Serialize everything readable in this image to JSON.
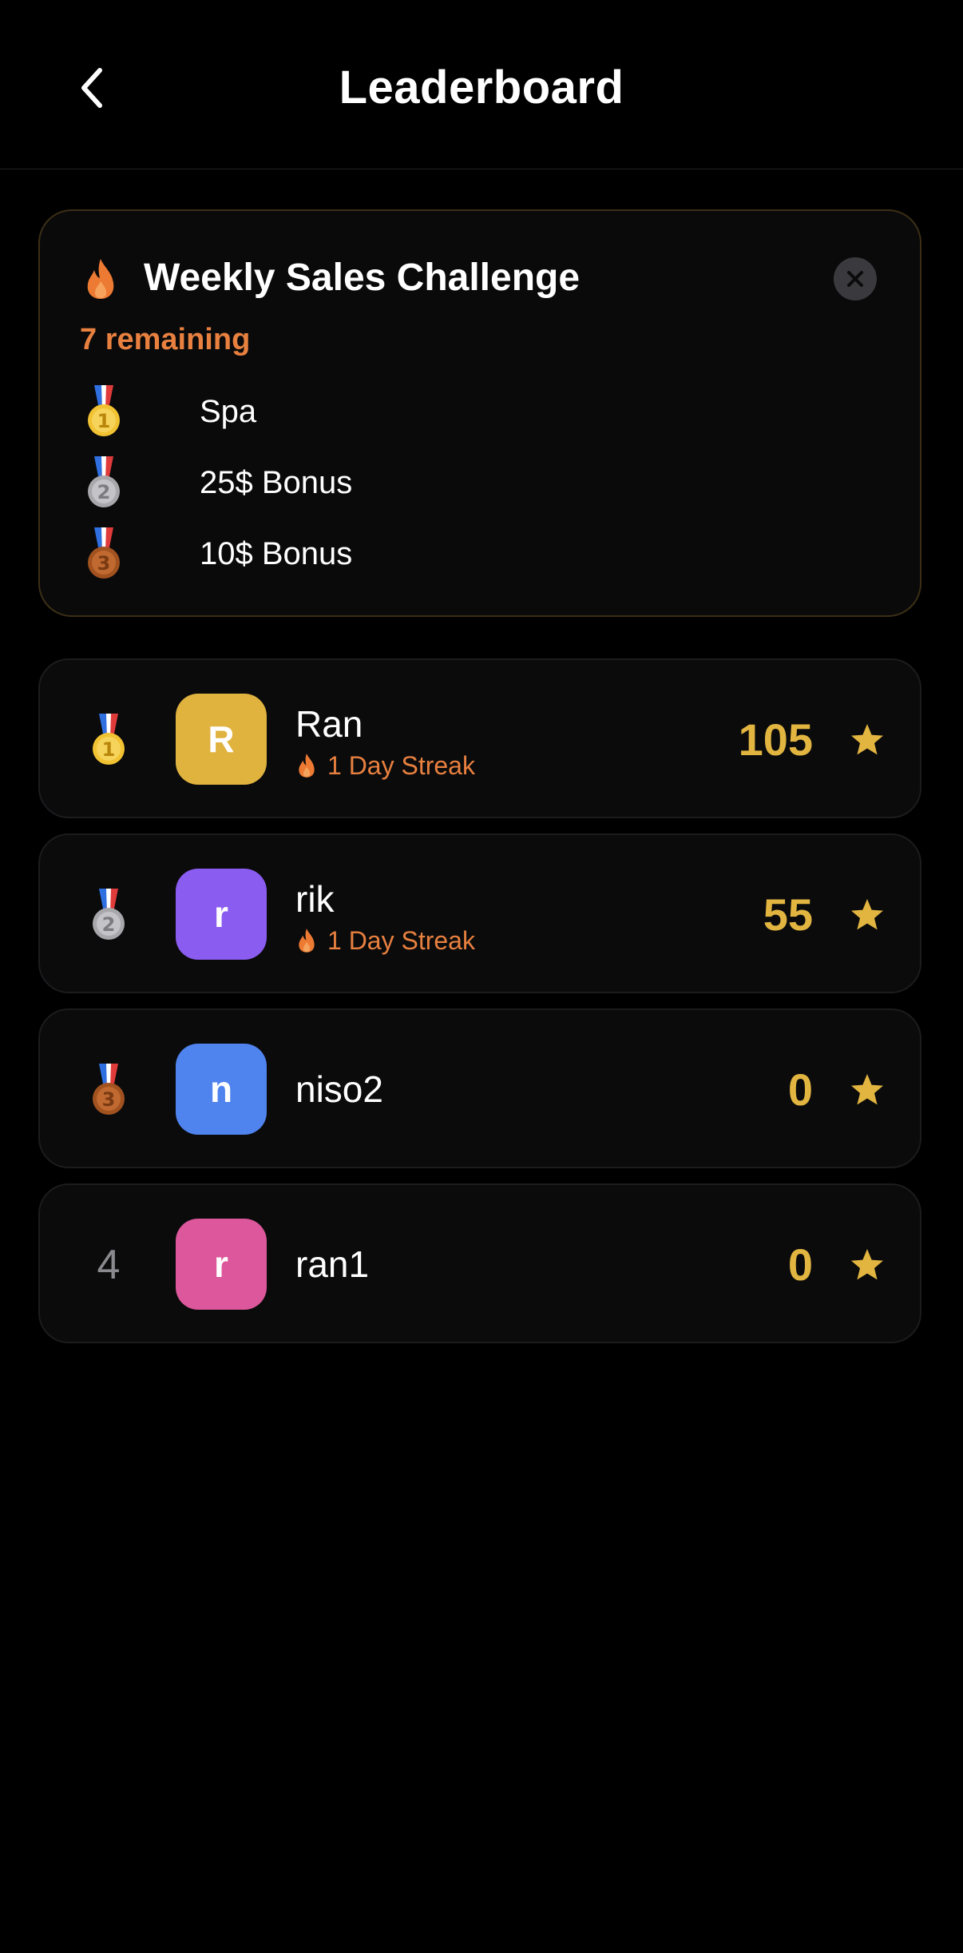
{
  "header": {
    "title": "Leaderboard",
    "back_icon": "chevron-left-icon"
  },
  "challenge": {
    "title": "Weekly Sales Challenge",
    "remaining": "7 remaining",
    "icon": "flame-icon",
    "close_icon": "close-icon",
    "prizes": [
      {
        "place": 1,
        "label": "Spa",
        "icon": "gold-medal-icon"
      },
      {
        "place": 2,
        "label": "25$ Bonus",
        "icon": "silver-medal-icon"
      },
      {
        "place": 3,
        "label": "10$ Bonus",
        "icon": "bronze-medal-icon"
      }
    ]
  },
  "leaderboard": [
    {
      "rank": "1",
      "rank_icon": "gold-medal-icon",
      "initial": "R",
      "name": "Ran",
      "streak": "1 Day Streak",
      "score": "105",
      "avatar_color": "#e0b33f"
    },
    {
      "rank": "2",
      "rank_icon": "silver-medal-icon",
      "initial": "r",
      "name": "rik",
      "streak": "1 Day Streak",
      "score": "55",
      "avatar_color": "#8b5cf0"
    },
    {
      "rank": "3",
      "rank_icon": "bronze-medal-icon",
      "initial": "n",
      "name": "niso2",
      "score": "0",
      "avatar_color": "#4f83ee"
    },
    {
      "rank": "4",
      "initial": "r",
      "name": "ran1",
      "score": "0",
      "avatar_color": "#dc579b"
    }
  ],
  "colors": {
    "background": "#000000",
    "card": "#0a0a0b",
    "accent_orange": "#e8803f",
    "score_gold": "#e2b540",
    "gold": "#f1c232",
    "silver": "#b4b4b8",
    "bronze": "#b8602a"
  }
}
